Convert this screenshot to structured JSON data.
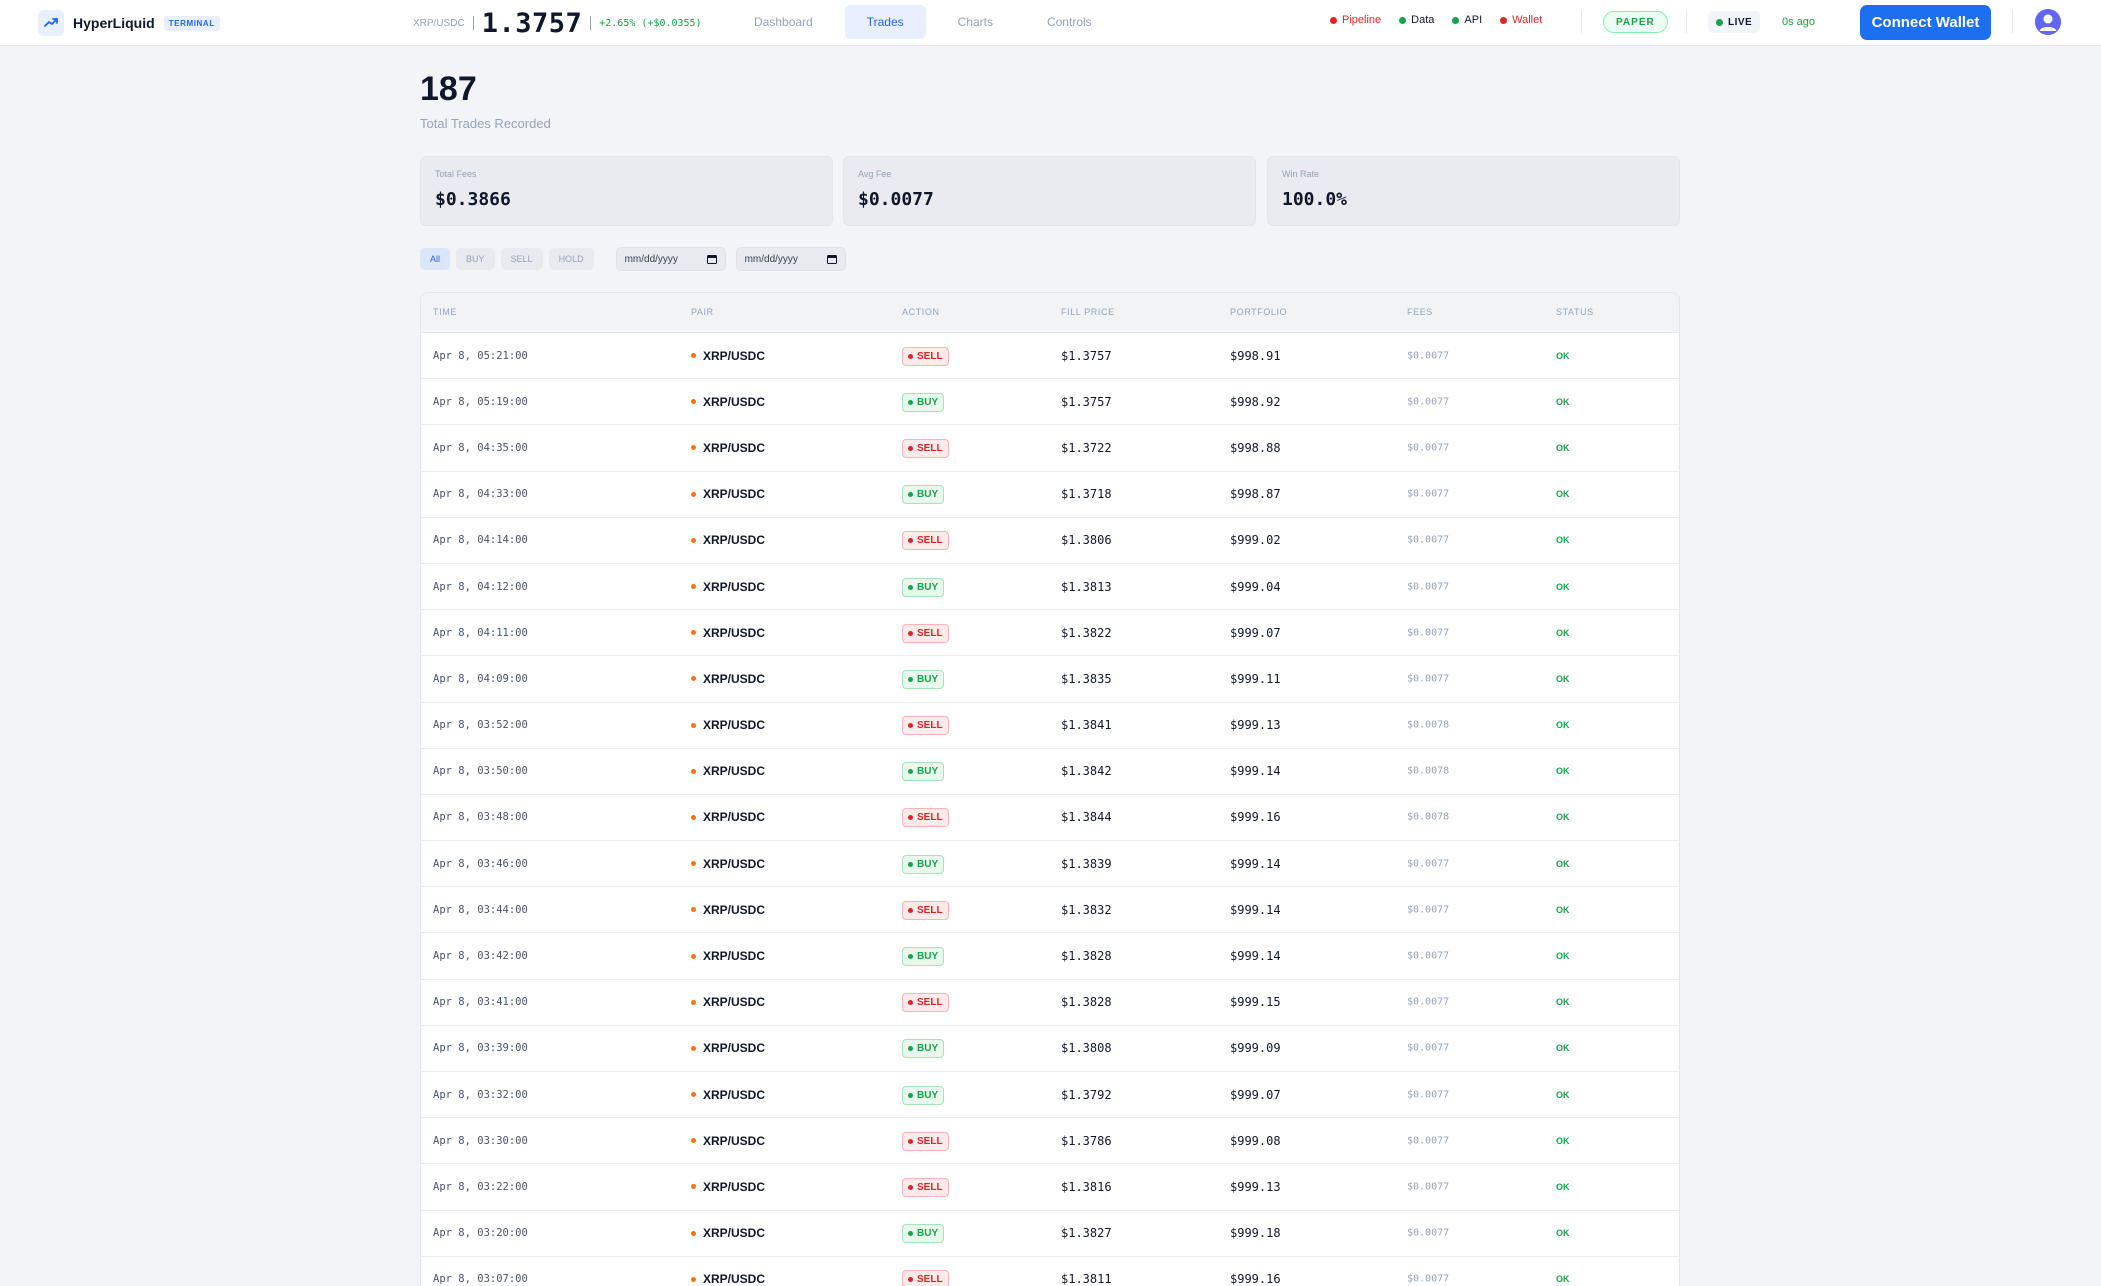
{
  "header": {
    "brand": "HyperLiquid",
    "brand_tag": "TERMINAL",
    "ticker": {
      "pair": "XRP/USDC",
      "price": "1.3757",
      "change": "+2.65% (+$0.0355)"
    },
    "nav": [
      {
        "label": "Dashboard",
        "active": false
      },
      {
        "label": "Trades",
        "active": true
      },
      {
        "label": "Charts",
        "active": false
      },
      {
        "label": "Controls",
        "active": false
      }
    ],
    "statuses": [
      {
        "label": "Pipeline",
        "color": "#dc2626",
        "text_color": "#dc2626"
      },
      {
        "label": "Data",
        "color": "#16a34a",
        "text_color": "#0f172a"
      },
      {
        "label": "API",
        "color": "#16a34a",
        "text_color": "#0f172a"
      },
      {
        "label": "Wallet",
        "color": "#dc2626",
        "text_color": "#dc2626"
      }
    ],
    "mode": "PAPER",
    "live": "LIVE",
    "last_update": "0s ago",
    "connect_label": "Connect Wallet"
  },
  "summary": {
    "total_trades": "187",
    "total_trades_label": "Total Trades Recorded",
    "cards": [
      {
        "label": "Total Fees",
        "value": "$0.3866"
      },
      {
        "label": "Avg Fee",
        "value": "$0.0077"
      },
      {
        "label": "Win Rate",
        "value": "100.0%"
      }
    ]
  },
  "filters": {
    "chips": [
      {
        "label": "All",
        "active": true
      },
      {
        "label": "BUY",
        "active": false
      },
      {
        "label": "SELL",
        "active": false
      },
      {
        "label": "HOLD",
        "active": false
      }
    ],
    "date_from": "mm/dd/yyyy",
    "date_to": "mm/dd/yyyy"
  },
  "table": {
    "columns": [
      "TIME",
      "PAIR",
      "ACTION",
      "FILL PRICE",
      "PORTFOLIO",
      "FEES",
      "STATUS"
    ],
    "rows": [
      {
        "time": "Apr 8, 05:21:00",
        "pair": "XRP/USDC",
        "action": "SELL",
        "price": "$1.3757",
        "portfolio": "$998.91",
        "fee": "$0.0077",
        "status": "OK"
      },
      {
        "time": "Apr 8, 05:19:00",
        "pair": "XRP/USDC",
        "action": "BUY",
        "price": "$1.3757",
        "portfolio": "$998.92",
        "fee": "$0.0077",
        "status": "OK"
      },
      {
        "time": "Apr 8, 04:35:00",
        "pair": "XRP/USDC",
        "action": "SELL",
        "price": "$1.3722",
        "portfolio": "$998.88",
        "fee": "$0.0077",
        "status": "OK"
      },
      {
        "time": "Apr 8, 04:33:00",
        "pair": "XRP/USDC",
        "action": "BUY",
        "price": "$1.3718",
        "portfolio": "$998.87",
        "fee": "$0.0077",
        "status": "OK"
      },
      {
        "time": "Apr 8, 04:14:00",
        "pair": "XRP/USDC",
        "action": "SELL",
        "price": "$1.3806",
        "portfolio": "$999.02",
        "fee": "$0.0077",
        "status": "OK"
      },
      {
        "time": "Apr 8, 04:12:00",
        "pair": "XRP/USDC",
        "action": "BUY",
        "price": "$1.3813",
        "portfolio": "$999.04",
        "fee": "$0.0077",
        "status": "OK"
      },
      {
        "time": "Apr 8, 04:11:00",
        "pair": "XRP/USDC",
        "action": "SELL",
        "price": "$1.3822",
        "portfolio": "$999.07",
        "fee": "$0.0077",
        "status": "OK"
      },
      {
        "time": "Apr 8, 04:09:00",
        "pair": "XRP/USDC",
        "action": "BUY",
        "price": "$1.3835",
        "portfolio": "$999.11",
        "fee": "$0.0077",
        "status": "OK"
      },
      {
        "time": "Apr 8, 03:52:00",
        "pair": "XRP/USDC",
        "action": "SELL",
        "price": "$1.3841",
        "portfolio": "$999.13",
        "fee": "$0.0078",
        "status": "OK"
      },
      {
        "time": "Apr 8, 03:50:00",
        "pair": "XRP/USDC",
        "action": "BUY",
        "price": "$1.3842",
        "portfolio": "$999.14",
        "fee": "$0.0078",
        "status": "OK"
      },
      {
        "time": "Apr 8, 03:48:00",
        "pair": "XRP/USDC",
        "action": "SELL",
        "price": "$1.3844",
        "portfolio": "$999.16",
        "fee": "$0.0078",
        "status": "OK"
      },
      {
        "time": "Apr 8, 03:46:00",
        "pair": "XRP/USDC",
        "action": "BUY",
        "price": "$1.3839",
        "portfolio": "$999.14",
        "fee": "$0.0077",
        "status": "OK"
      },
      {
        "time": "Apr 8, 03:44:00",
        "pair": "XRP/USDC",
        "action": "SELL",
        "price": "$1.3832",
        "portfolio": "$999.14",
        "fee": "$0.0077",
        "status": "OK"
      },
      {
        "time": "Apr 8, 03:42:00",
        "pair": "XRP/USDC",
        "action": "BUY",
        "price": "$1.3828",
        "portfolio": "$999.14",
        "fee": "$0.0077",
        "status": "OK"
      },
      {
        "time": "Apr 8, 03:41:00",
        "pair": "XRP/USDC",
        "action": "SELL",
        "price": "$1.3828",
        "portfolio": "$999.15",
        "fee": "$0.0077",
        "status": "OK"
      },
      {
        "time": "Apr 8, 03:39:00",
        "pair": "XRP/USDC",
        "action": "BUY",
        "price": "$1.3808",
        "portfolio": "$999.09",
        "fee": "$0.0077",
        "status": "OK"
      },
      {
        "time": "Apr 8, 03:32:00",
        "pair": "XRP/USDC",
        "action": "BUY",
        "price": "$1.3792",
        "portfolio": "$999.07",
        "fee": "$0.0077",
        "status": "OK"
      },
      {
        "time": "Apr 8, 03:30:00",
        "pair": "XRP/USDC",
        "action": "SELL",
        "price": "$1.3786",
        "portfolio": "$999.08",
        "fee": "$0.0077",
        "status": "OK"
      },
      {
        "time": "Apr 8, 03:22:00",
        "pair": "XRP/USDC",
        "action": "SELL",
        "price": "$1.3816",
        "portfolio": "$999.13",
        "fee": "$0.0077",
        "status": "OK"
      },
      {
        "time": "Apr 8, 03:20:00",
        "pair": "XRP/USDC",
        "action": "BUY",
        "price": "$1.3827",
        "portfolio": "$999.18",
        "fee": "$0.0077",
        "status": "OK"
      },
      {
        "time": "Apr 8, 03:07:00",
        "pair": "XRP/USDC",
        "action": "SELL",
        "price": "$1.3811",
        "portfolio": "$999.16",
        "fee": "$0.0077",
        "status": "OK"
      }
    ]
  }
}
